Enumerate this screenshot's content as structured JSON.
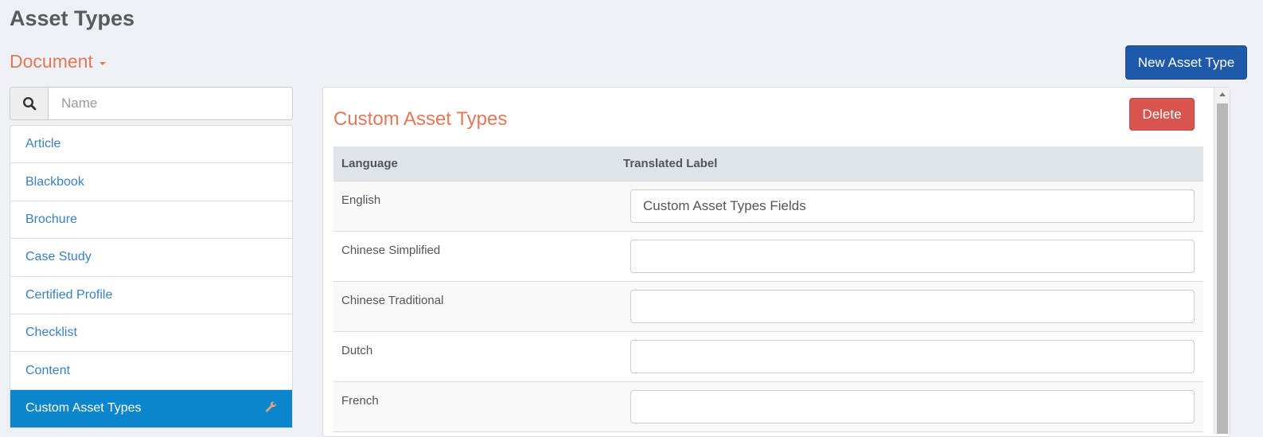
{
  "header": {
    "title": "Asset Types",
    "category": "Document",
    "new_button": "New Asset Type"
  },
  "search": {
    "placeholder": "Name",
    "value": ""
  },
  "asset_types": [
    {
      "label": "Article"
    },
    {
      "label": "Blackbook"
    },
    {
      "label": "Brochure"
    },
    {
      "label": "Case Study"
    },
    {
      "label": "Certified Profile"
    },
    {
      "label": "Checklist"
    },
    {
      "label": "Content"
    },
    {
      "label": "Custom Asset Types",
      "selected": true
    }
  ],
  "detail": {
    "title": "Custom Asset Types",
    "delete_button": "Delete",
    "columns": {
      "language": "Language",
      "label": "Translated Label"
    },
    "rows": [
      {
        "language": "English",
        "value": "Custom Asset Types Fields"
      },
      {
        "language": "Chinese Simplified",
        "value": ""
      },
      {
        "language": "Chinese Traditional",
        "value": ""
      },
      {
        "language": "Dutch",
        "value": ""
      },
      {
        "language": "French",
        "value": ""
      }
    ]
  },
  "colors": {
    "accent": "#e2785a",
    "primary_button": "#1e5aa8",
    "danger_button": "#d9534f",
    "selected_item": "#0a86cf",
    "link": "#3a81c0"
  },
  "icons": {
    "search": "search-icon",
    "caret": "caret-down-icon",
    "edit": "wrench-icon"
  }
}
